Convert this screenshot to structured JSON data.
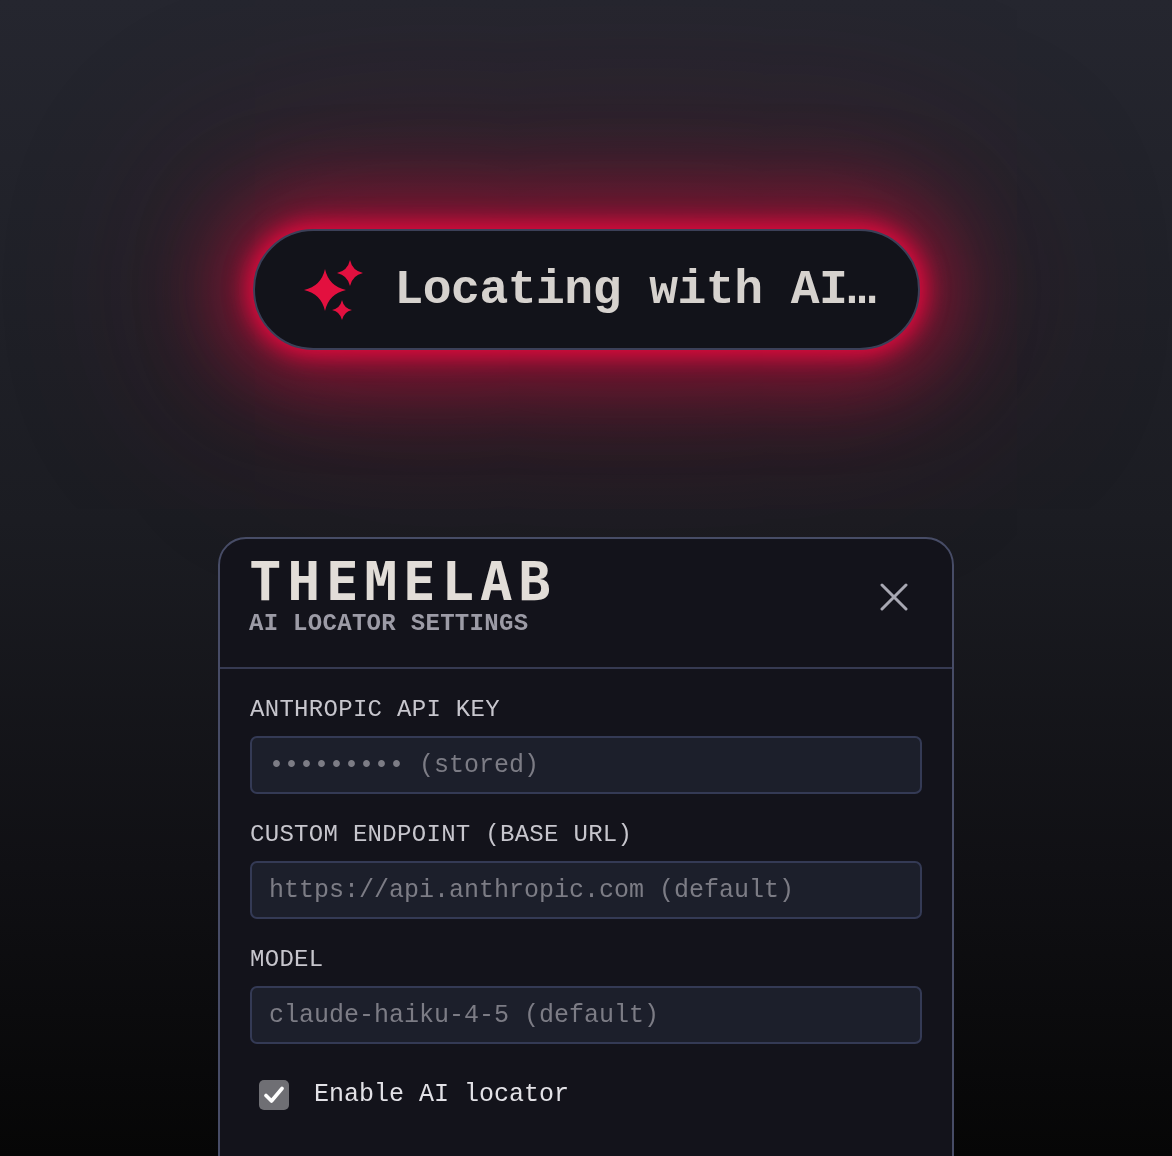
{
  "status_pill": {
    "label": "Locating with AI…"
  },
  "panel": {
    "title": "THEMELAB",
    "subtitle": "AI LOCATOR SETTINGS"
  },
  "fields": [
    {
      "label": "ANTHROPIC API KEY",
      "placeholder": "••••••••• (stored)"
    },
    {
      "label": "CUSTOM ENDPOINT (BASE URL)",
      "placeholder": "https://api.anthropic.com (default)"
    },
    {
      "label": "MODEL",
      "placeholder": "claude-haiku-4-5 (default)"
    }
  ],
  "checkbox": {
    "label": "Enable AI locator",
    "checked": true
  }
}
